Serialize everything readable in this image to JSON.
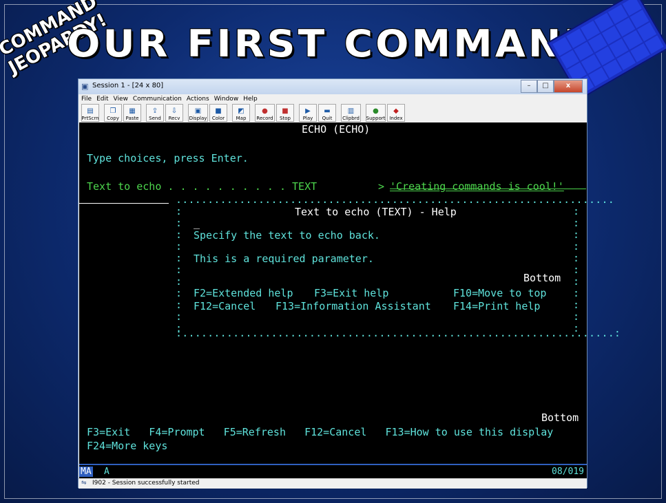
{
  "slide": {
    "title": "OUR FIRST COMMAND",
    "logo_line1": "COMMAND",
    "logo_line2": "JEOPARDY!"
  },
  "window": {
    "title": "Session 1 - [24 x 80]",
    "menu": [
      "File",
      "Edit",
      "View",
      "Communication",
      "Actions",
      "Window",
      "Help"
    ],
    "toolbar": [
      "PrtScrn",
      "Copy",
      "Paste",
      "Send",
      "Recv",
      "Display",
      "Color",
      "Map",
      "Record",
      "Stop",
      "Play",
      "Quit",
      "Clipbrd",
      "Support",
      "Index"
    ],
    "controls": {
      "minimize": "–",
      "maximize": "□",
      "close": "x"
    }
  },
  "terminal": {
    "header": "ECHO (ECHO)",
    "instruction": "Type choices, press Enter.",
    "param_label": "Text to echo . . . . . . . . . . TEXT",
    "param_arrow": ">",
    "param_value": "'Creating commands is cool!'",
    "help": {
      "title": "Text to echo (TEXT) - Help",
      "line1": "Specify the text to echo back.",
      "line2": "This is a required parameter.",
      "bottom": "Bottom",
      "keys1a": "F2=Extended help",
      "keys1b": "F3=Exit help",
      "keys1c": "F10=Move to top",
      "keys2a": "F12=Cancel",
      "keys2b": "F13=Information Assistant",
      "keys2c": "F14=Print help"
    },
    "bottom": "Bottom",
    "fkeys1": "F3=Exit   F4=Prompt   F5=Refresh   F12=Cancel   F13=How to use this display",
    "fkeys2": "F24=More keys"
  },
  "oia": {
    "mode": "MA",
    "indicator": "A",
    "cursor": "08/019"
  },
  "status": {
    "text": "I902 - Session successfully started"
  }
}
